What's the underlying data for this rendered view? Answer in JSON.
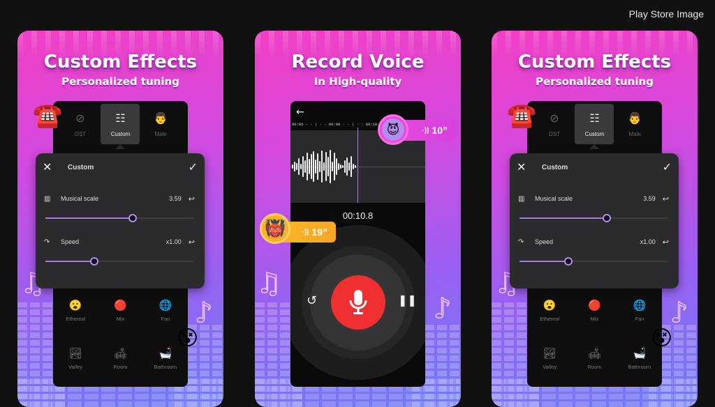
{
  "header": {
    "label": "Play Store Image"
  },
  "cards": [
    {
      "title": "Custom Effects",
      "subtitle": "Personalized tuning",
      "tabs": [
        {
          "label": "OST",
          "icon": "no-entry-icon"
        },
        {
          "label": "Custom",
          "icon": "sliders-icon",
          "active": true
        },
        {
          "label": "Male",
          "icon": "male-avatar-icon"
        }
      ],
      "panel": {
        "title": "Custom",
        "close_icon": "close-icon",
        "confirm_icon": "check-icon",
        "params": [
          {
            "label": "Musical scale",
            "value": "3.59",
            "icon": "piano-icon",
            "fraction": 0.59
          },
          {
            "label": "Speed",
            "value": "x1.00",
            "icon": "speed-icon",
            "fraction": 0.33
          }
        ]
      },
      "effects": [
        {
          "label": "Ethereal",
          "icon": "ethereal-icon"
        },
        {
          "label": "Mix",
          "icon": "mix-icon"
        },
        {
          "label": "Fan",
          "icon": "fan-icon"
        },
        {
          "label": "Valley",
          "icon": "valley-icon"
        },
        {
          "label": "Room",
          "icon": "room-icon"
        },
        {
          "label": "Bathroom",
          "icon": "bathroom-icon"
        }
      ]
    },
    {
      "title": "Record Voice",
      "subtitle": "In High-quality",
      "ruler": "00:06 · · | · · 00:08 · · | · · 00:10 · · | · · 00:12",
      "elapsed": "00:10.8",
      "badges": [
        {
          "duration": "10”",
          "color": "#e73fd6"
        },
        {
          "duration": "19”",
          "color": "#f7a92a"
        }
      ],
      "colors": {
        "record": "#ef2f30",
        "accent": "#a07de0"
      }
    },
    {
      "title": "Custom Effects",
      "subtitle": "Personalized tuning",
      "tabs": [
        {
          "label": "OST",
          "icon": "no-entry-icon"
        },
        {
          "label": "Custom",
          "icon": "sliders-icon",
          "active": true
        },
        {
          "label": "Male",
          "icon": "male-avatar-icon"
        }
      ],
      "panel": {
        "title": "Custom",
        "params": [
          {
            "label": "Musical scale",
            "value": "3.59",
            "fraction": 0.59
          },
          {
            "label": "Speed",
            "value": "x1.00",
            "fraction": 0.33
          }
        ]
      },
      "effects": [
        {
          "label": "Ethereal"
        },
        {
          "label": "Mix"
        },
        {
          "label": "Fan"
        },
        {
          "label": "Valley"
        },
        {
          "label": "Room"
        },
        {
          "label": "Bathroom"
        }
      ]
    }
  ]
}
